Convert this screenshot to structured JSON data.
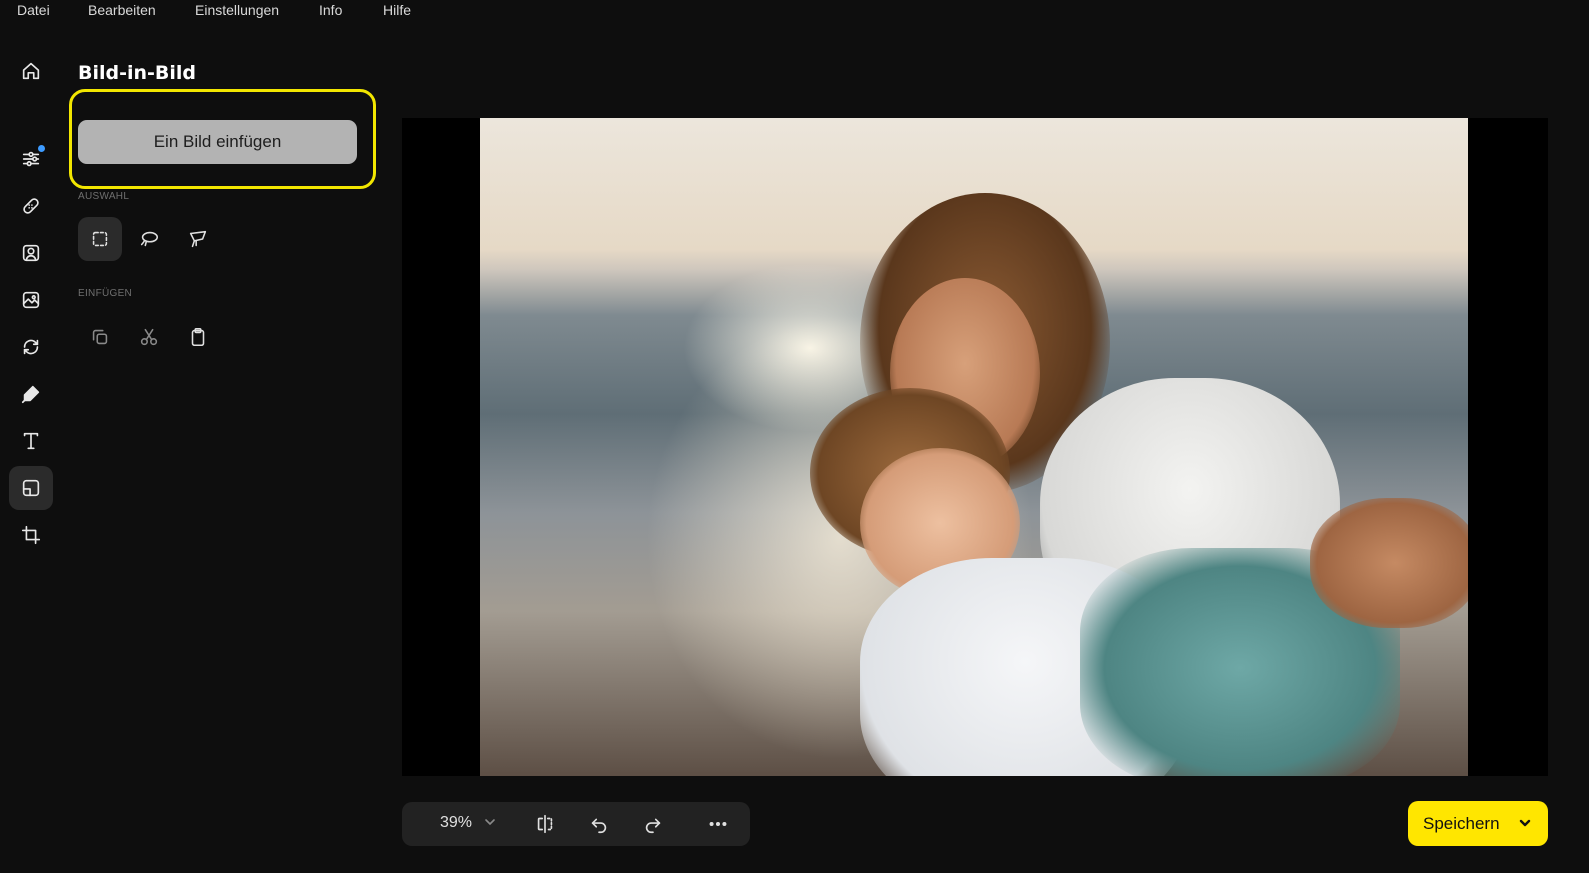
{
  "menu": {
    "items": [
      "Datei",
      "Bearbeiten",
      "Einstellungen",
      "Info",
      "Hilfe"
    ]
  },
  "rail": {
    "icons": [
      "home-icon",
      "sliders-icon",
      "bandage-icon",
      "portrait-icon",
      "image-edit-icon",
      "rotate-icon",
      "magic-icon",
      "text-icon",
      "picture-in-picture-icon",
      "crop-icon"
    ],
    "active": "picture-in-picture-icon",
    "notification_dot_color": "#3d9bff"
  },
  "panel": {
    "title": "Bild-in-Bild",
    "insert_button_label": "Ein Bild einfügen",
    "selection_label": "AUSWAHL",
    "insert_label": "EINFÜGEN",
    "selection_tools": [
      "rect-select-icon",
      "lasso-icon",
      "polygon-lasso-icon"
    ],
    "insert_tools": [
      "copy-icon",
      "cut-icon",
      "paste-icon"
    ],
    "highlight_color": "#f2e600"
  },
  "canvas": {
    "image_description_icon": "photo-mother-child-beach"
  },
  "bottombar": {
    "zoom": "39%",
    "icons": [
      "compare-icon",
      "undo-icon",
      "redo-icon",
      "more-icon"
    ]
  },
  "save": {
    "label": "Speichern",
    "color": "#ffe600"
  }
}
